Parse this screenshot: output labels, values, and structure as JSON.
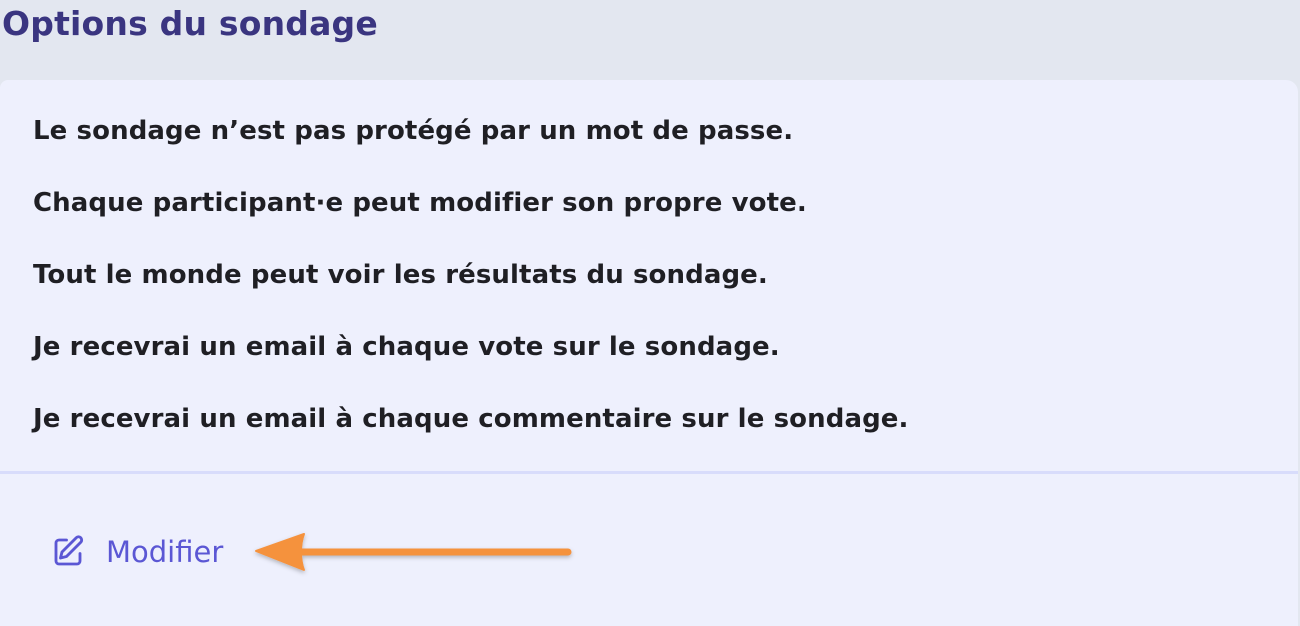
{
  "section": {
    "title": "Options du sondage"
  },
  "options": [
    "Le sondage n’est pas protégé par un mot de passe.",
    "Chaque participant·e peut modifier son propre vote.",
    "Tout le monde peut voir les résultats du sondage.",
    "Je recevrai un email à chaque vote sur le sondage.",
    "Je recevrai un email à chaque commentaire sur le sondage."
  ],
  "actions": {
    "modify_label": "Modifier",
    "modify_icon": "edit-icon"
  },
  "colors": {
    "title": "#3a3580",
    "accent": "#5b57d4",
    "card_background": "#eef0fd",
    "page_background": "#e3e7f0",
    "annotation_arrow": "#f5923e"
  }
}
